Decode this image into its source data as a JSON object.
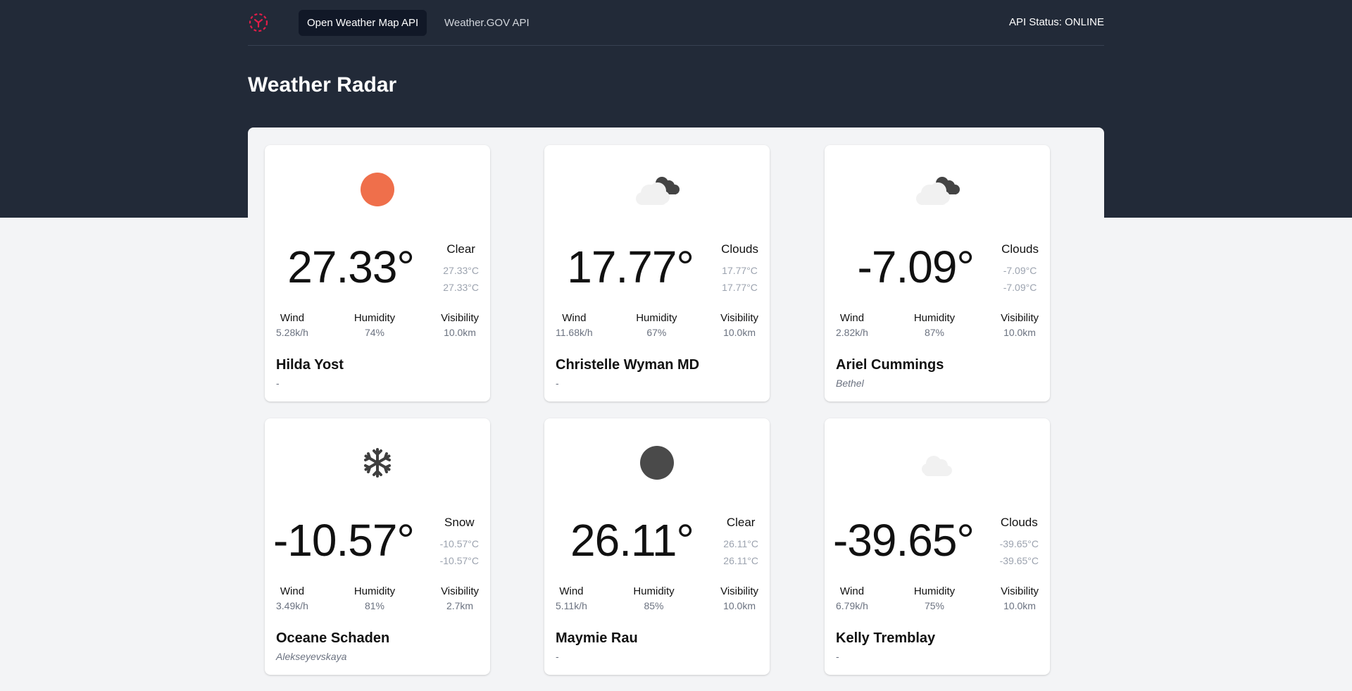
{
  "nav": {
    "tabs": [
      {
        "label": "Open Weather Map API",
        "active": true
      },
      {
        "label": "Weather.GOV API",
        "active": false
      }
    ],
    "api_status": "API Status: ONLINE"
  },
  "page": {
    "title": "Weather Radar"
  },
  "colors": {
    "header_bg": "#222a38",
    "logo": "#e11d48",
    "sun": "#ef6f4b",
    "dark_icon": "#4a4a4a"
  },
  "cards": [
    {
      "icon": "sun-icon",
      "temp": "27.33°",
      "condition": "Clear",
      "feels": "27.33°C",
      "temp2": "27.33°C",
      "wind_label": "Wind",
      "wind": "5.28k/h",
      "humidity_label": "Humidity",
      "humidity": "74%",
      "visibility_label": "Visibility",
      "visibility": "10.0km",
      "city": "Hilda Yost",
      "region": "-"
    },
    {
      "icon": "clouds-icon",
      "temp": "17.77°",
      "condition": "Clouds",
      "feels": "17.77°C",
      "temp2": "17.77°C",
      "wind_label": "Wind",
      "wind": "11.68k/h",
      "humidity_label": "Humidity",
      "humidity": "67%",
      "visibility_label": "Visibility",
      "visibility": "10.0km",
      "city": "Christelle Wyman MD",
      "region": "-"
    },
    {
      "icon": "clouds-icon",
      "temp": "-7.09°",
      "condition": "Clouds",
      "feels": "-7.09°C",
      "temp2": "-7.09°C",
      "wind_label": "Wind",
      "wind": "2.82k/h",
      "humidity_label": "Humidity",
      "humidity": "87%",
      "visibility_label": "Visibility",
      "visibility": "10.0km",
      "city": "Ariel Cummings",
      "region": "Bethel"
    },
    {
      "icon": "snowflake-icon",
      "temp": "-10.57°",
      "condition": "Snow",
      "feels": "-10.57°C",
      "temp2": "-10.57°C",
      "wind_label": "Wind",
      "wind": "3.49k/h",
      "humidity_label": "Humidity",
      "humidity": "81%",
      "visibility_label": "Visibility",
      "visibility": "2.7km",
      "city": "Oceane Schaden",
      "region": "Alekseyevskaya"
    },
    {
      "icon": "moon-icon",
      "temp": "26.11°",
      "condition": "Clear",
      "feels": "26.11°C",
      "temp2": "26.11°C",
      "wind_label": "Wind",
      "wind": "5.11k/h",
      "humidity_label": "Humidity",
      "humidity": "85%",
      "visibility_label": "Visibility",
      "visibility": "10.0km",
      "city": "Maymie Rau",
      "region": "-"
    },
    {
      "icon": "cloud-icon",
      "temp": "-39.65°",
      "condition": "Clouds",
      "feels": "-39.65°C",
      "temp2": "-39.65°C",
      "wind_label": "Wind",
      "wind": "6.79k/h",
      "humidity_label": "Humidity",
      "humidity": "75%",
      "visibility_label": "Visibility",
      "visibility": "10.0km",
      "city": "Kelly Tremblay",
      "region": "-"
    }
  ]
}
